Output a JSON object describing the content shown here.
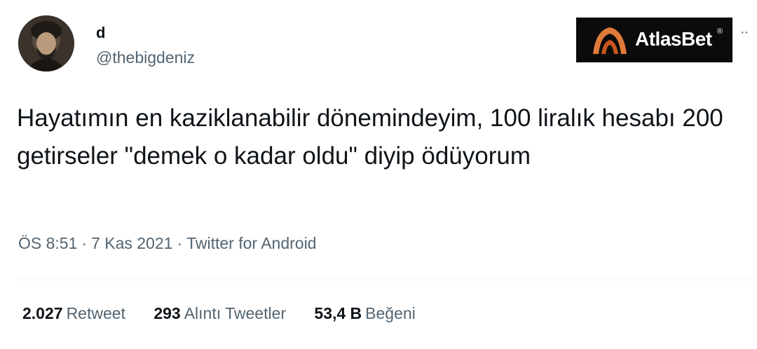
{
  "author": {
    "display_name": "d",
    "handle": "@thebigdeniz"
  },
  "brand": {
    "name": "AtlasBet",
    "reg": "®",
    "accent": "#e07a3a"
  },
  "tweet": {
    "text": "Hayatımın en kaziklanabilir dönemindeyim, 100 liralık hesabı 200 getirseler \"demek o kadar oldu\" diyip ödüyorum"
  },
  "meta": {
    "time": "ÖS 8:51",
    "date": "7 Kas 2021",
    "source": "Twitter for Android",
    "separator": "·"
  },
  "stats": {
    "retweets": {
      "count": "2.027",
      "label": "Retweet"
    },
    "quotes": {
      "count": "293",
      "label": "Alıntı Tweetler"
    },
    "likes": {
      "count": "53,4 B",
      "label": "Beğeni"
    }
  },
  "icons": {
    "more": "more-options-icon",
    "brand_logo": "atlasbet-logo-icon"
  },
  "colors": {
    "text": "#0f1419",
    "secondary": "#536471",
    "divider": "#eff3f4"
  }
}
